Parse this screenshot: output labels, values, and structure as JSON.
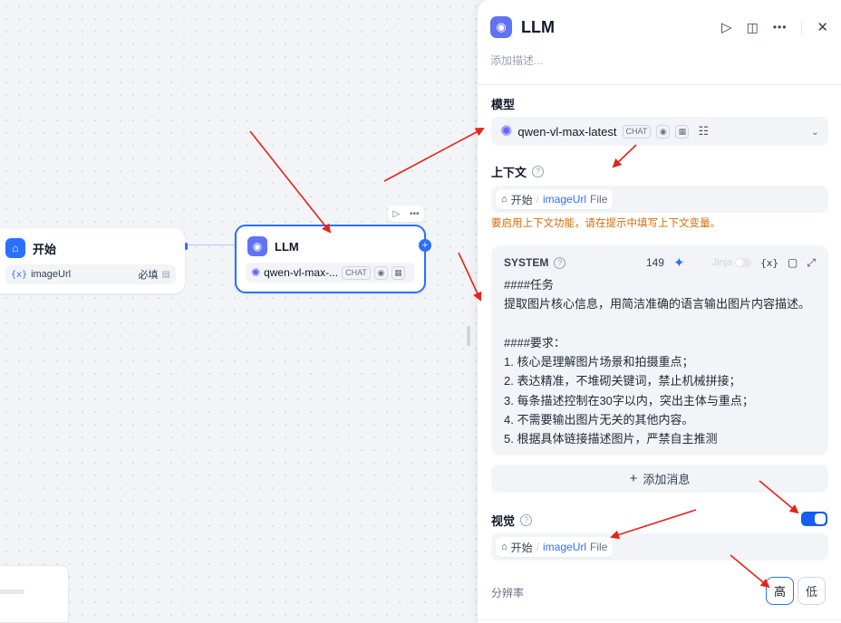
{
  "canvas": {
    "start_node": {
      "title": "开始",
      "var_glyph": "{x}",
      "var_name": "imageUrl",
      "required": "必填"
    },
    "llm_node": {
      "title": "LLM",
      "model": "qwen-vl-max-...",
      "model_tag": "CHAT"
    },
    "node_toolbar": {
      "run_icon": "▷",
      "more_icon": "•••"
    }
  },
  "panel": {
    "title": "LLM",
    "description_placeholder": "添加描述...",
    "model_section": {
      "label": "模型",
      "model_name": "qwen-vl-max-latest",
      "tag": "CHAT"
    },
    "context_section": {
      "label": "上下文",
      "source_node": "开始",
      "separator": "/",
      "variable": "imageUrl",
      "type": "File",
      "warning": "要启用上下文功能，请在提示中填写上下文变量。"
    },
    "system_prompt": {
      "label": "SYSTEM",
      "char_count": "149",
      "jinja_label": "Jinja",
      "var_insert": "{x}",
      "lines": [
        "####任务",
        "提取图片核心信息，用简洁准确的语言输出图片内容描述。",
        "",
        "####要求：",
        "1. 核心是理解图片场景和拍摄重点；",
        "2. 表达精准，不堆砌关键词，禁止机械拼接；",
        "3. 每条描述控制在30字以内，突出主体与重点；",
        "4. 不需要输出图片无关的其他内容。",
        "5. 根据具体链接描述图片，严禁自主推测"
      ]
    },
    "add_message": {
      "plus": "+",
      "label": "添加消息"
    },
    "vision_section": {
      "label": "视觉",
      "enabled": true,
      "source_node": "开始",
      "separator": "/",
      "variable": "imageUrl",
      "type": "File"
    },
    "resolution": {
      "label": "分辨率",
      "options": [
        "高",
        "低"
      ],
      "selected": "高"
    }
  },
  "colors": {
    "accent": "#2970ff",
    "llm_icon": "#6172f3",
    "warning": "#dc6803",
    "annotation_arrow": "#e8231a"
  }
}
